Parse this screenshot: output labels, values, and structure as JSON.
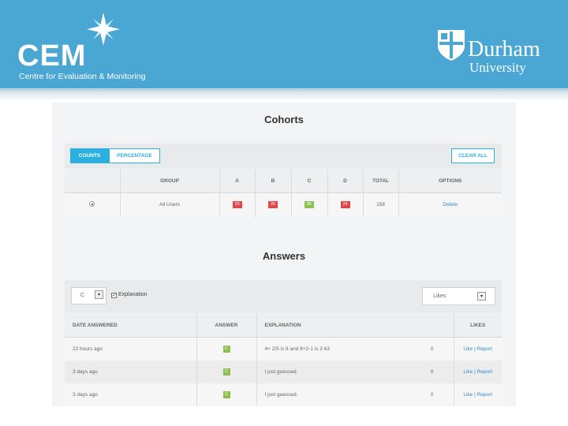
{
  "header": {
    "logo_text": "CEM",
    "logo_tagline": "Centre for Evaluation & Monitoring",
    "university_name": "Durham",
    "university_sub": "University",
    "background_color": "#4aa6d2"
  },
  "cohorts": {
    "title": "Cohorts",
    "toggle_counts": "COUNTS",
    "toggle_percentage": "PERCENTAGE",
    "clear_all": "CLEAR ALL",
    "columns": [
      "GROUP",
      "A",
      "B",
      "C",
      "D",
      "TOTAL",
      "OPTIONS"
    ],
    "rows": [
      {
        "group": "All Users",
        "a": "23",
        "b": "25",
        "c": "85",
        "d": "24",
        "total": "158",
        "option": "Delete"
      }
    ]
  },
  "answers": {
    "title": "Answers",
    "answer_select_value": "C",
    "explanation_label": "Explanation",
    "explanation_checked": true,
    "sort_select_value": "Likes",
    "columns": [
      "DATE ANSWERED",
      "ANSWER",
      "EXPLANATION",
      "LIKES"
    ],
    "rows": [
      {
        "date": "22 hours ago",
        "answer": "C",
        "explanation": "4+ 2/5 is 8 and 8+2-1 is 3 63",
        "likes": "0",
        "actions": "Like | Report"
      },
      {
        "date": "3 days ago",
        "answer": "C",
        "explanation": "I just guessed.",
        "likes": "0",
        "actions": "Like | Report"
      },
      {
        "date": "3 days ago",
        "answer": "C",
        "explanation": "I just guessed.",
        "likes": "0",
        "actions": "Like | Report"
      }
    ]
  },
  "colors": {
    "accent": "#2bb0e0",
    "badge_red": "#e04848",
    "badge_green": "#8cc152"
  }
}
